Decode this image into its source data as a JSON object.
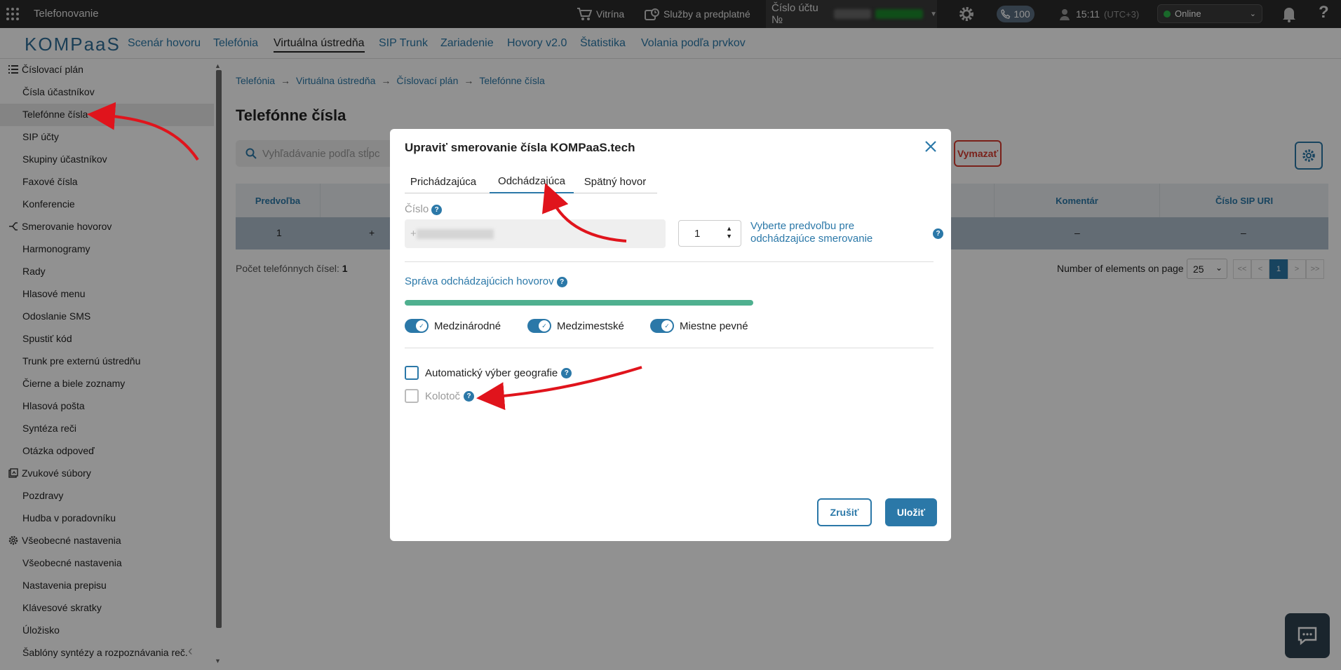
{
  "app": {
    "title": "Telefonovanie"
  },
  "topbar": {
    "vitrina": "Vitrína",
    "services": "Služby a predplatné",
    "account_label": "Číslo účtu №",
    "balance": "100",
    "time": "15:11",
    "timezone": "(UTC+3)",
    "status": "Online"
  },
  "nav": {
    "logo": "KOMPaaS",
    "items": [
      "Scenár hovoru",
      "Telefónia",
      "Virtuálna ústredňa",
      "SIP Trunk",
      "Zariadenie",
      "Hovory v2.0",
      "Štatistika",
      "Volania podľa prvkov"
    ],
    "active": "Virtuálna ústredňa"
  },
  "sidebar": {
    "groups": [
      {
        "label": "Číslovací plán",
        "items": [
          "Čísla účastníkov",
          "Telefónne čísla",
          "SIP účty",
          "Skupiny účastníkov",
          "Faxové čísla",
          "Konferencie"
        ]
      },
      {
        "label": "Smerovanie hovorov",
        "items": [
          "Harmonogramy",
          "Rady",
          "Hlasové menu",
          "Odoslanie SMS",
          "Spustiť kód",
          "Trunk pre externú ústredňu",
          "Čierne a biele zoznamy",
          "Hlasová pošta",
          "Syntéza reči",
          "Otázka odpoveď"
        ]
      },
      {
        "label": "Zvukové súbory",
        "items": [
          "Pozdravy",
          "Hudba v poradovníku"
        ]
      },
      {
        "label": "Všeobecné nastavenia",
        "items": [
          "Všeobecné nastavenia",
          "Nastavenia prepisu",
          "Klávesové skratky",
          "Úložisko",
          "Šablóny syntézy a rozpoznávania reč."
        ]
      }
    ],
    "selected": "Telefónne čísla"
  },
  "main": {
    "breadcrumb": [
      "Telefónia",
      "Virtuálna ústredňa",
      "Číslovací plán",
      "Telefónne čísla"
    ],
    "title": "Telefónne čísla",
    "search_placeholder": "Vyhľadávanie podľa stĺpc",
    "delete_label": "Vymazať",
    "table": {
      "headers": [
        "Predvoľba",
        "Komentár",
        "Číslo SIP URI"
      ],
      "row": {
        "prefix": "1",
        "number": "+",
        "comment": "–",
        "sip_uri": "–"
      }
    },
    "count_label": "Počet telefónnych čísel:",
    "count_value": "1",
    "per_page_label": "Number of elements on page",
    "per_page_value": "25",
    "pagination": [
      "<<",
      "<",
      "1",
      ">",
      ">>"
    ]
  },
  "modal": {
    "title": "Upraviť smerovanie čísla KOMPaaS.tech",
    "tabs": [
      "Prichádzajúca",
      "Odchádzajúca",
      "Spätný hovor"
    ],
    "active_tab": "Odchádzajúca",
    "number_label": "Číslo",
    "number_value": "+",
    "prefix_value": "1",
    "prefix_hint": "Vyberte predvoľbu pre odchádzajúce smerovanie",
    "section_title": "Správa odchádzajúcich hovorov",
    "toggles": [
      {
        "label": "Medzinárodné",
        "on": true
      },
      {
        "label": "Medzimestské",
        "on": true
      },
      {
        "label": "Miestne pevné",
        "on": true
      }
    ],
    "checkbox_geo": "Automatický výber geografie",
    "checkbox_carousel": "Kolotoč",
    "cancel_label": "Zrušiť",
    "save_label": "Uložiť"
  },
  "colors": {
    "accent": "#2b78a8",
    "danger": "#d63b2f",
    "progress": "#4fb08f",
    "annotation": "#e0141c"
  }
}
